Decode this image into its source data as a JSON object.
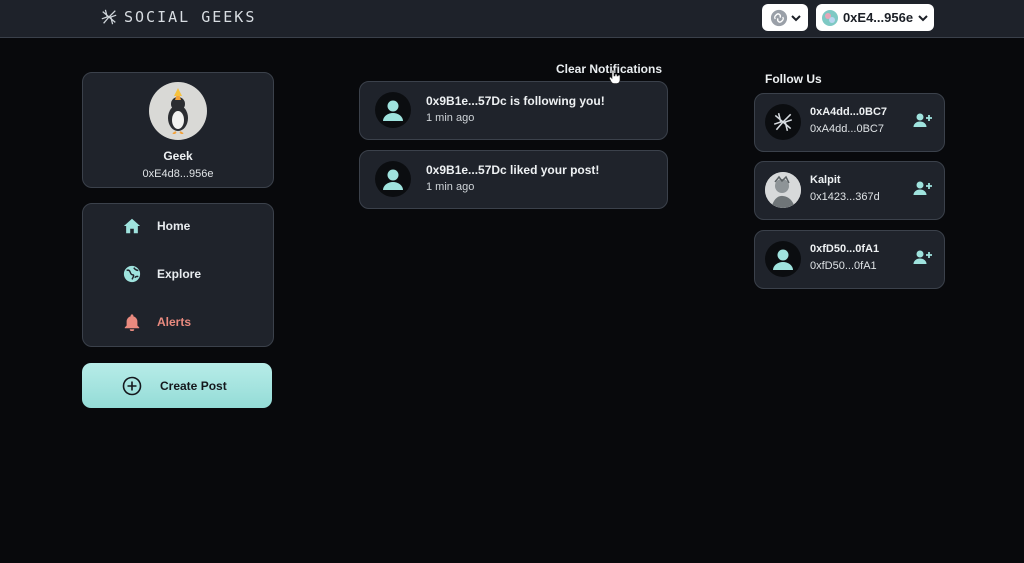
{
  "app": {
    "logo_text": "SOCIAL GEEKS"
  },
  "topbar": {
    "account_label": "0xE4...956e"
  },
  "profile": {
    "name": "Geek",
    "address": "0xE4d8...956e"
  },
  "nav": {
    "items": [
      {
        "label": "Home",
        "icon": "home-icon",
        "color": "#e8ecef"
      },
      {
        "label": "Explore",
        "icon": "globe-icon",
        "color": "#e8ecef"
      },
      {
        "label": "Alerts",
        "icon": "bell-icon",
        "color": "#e98a7f",
        "active": true
      }
    ],
    "create_post_label": "Create Post"
  },
  "notifications": {
    "clear_label": "Clear Notifications",
    "items": [
      {
        "message": "0x9B1e...57Dc is following you!",
        "time": "1 min ago"
      },
      {
        "message": "0x9B1e...57Dc liked your post!",
        "time": "1 min ago"
      }
    ]
  },
  "follow": {
    "title": "Follow Us",
    "items": [
      {
        "name": "0xA4dd...0BC7",
        "address": "0xA4dd...0BC7",
        "avatar": "logo"
      },
      {
        "name": "Kalpit",
        "address": "0x1423...367d",
        "avatar": "photo"
      },
      {
        "name": "0xfD50...0fA1",
        "address": "0xfD50...0fA1",
        "avatar": "default"
      }
    ]
  },
  "colors": {
    "accent": "#9fe3de",
    "alert": "#e98a7f",
    "card": "#1f232b",
    "topbar": "#1e222a"
  }
}
